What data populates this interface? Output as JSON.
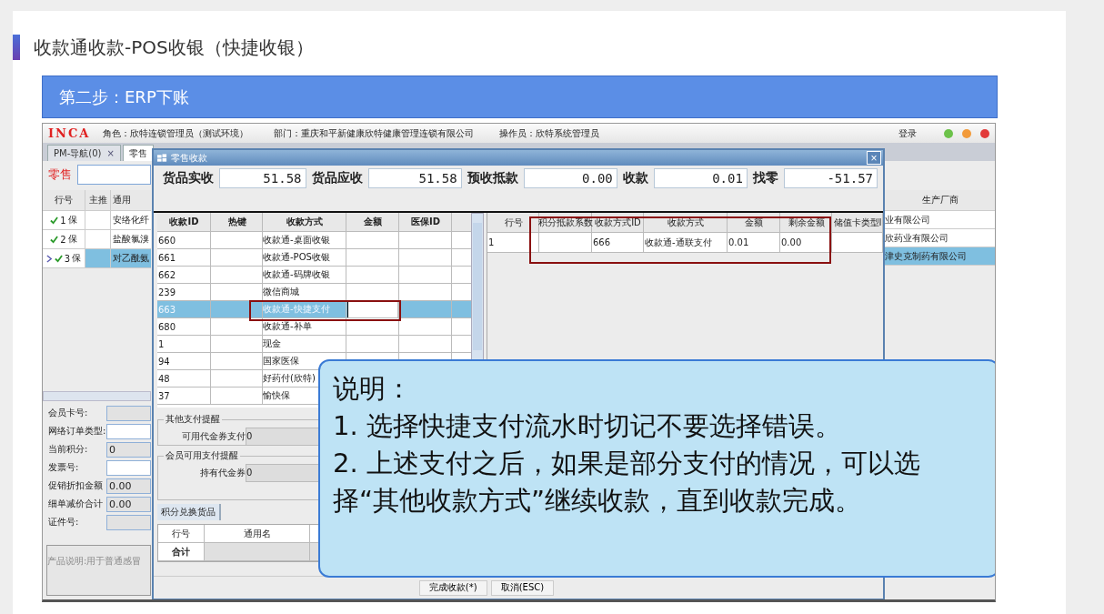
{
  "page_title": "收款通收款-POS收银（快捷收银）",
  "banner": "第二步：ERP下账",
  "app": {
    "logo": "INCA",
    "role": "角色：欣特连锁管理员（测试环境）",
    "department": "部门：重庆和平新健康欣特健康管理连锁有限公司",
    "operator": "操作员：欣特系统管理员",
    "login": "登录",
    "tabs": [
      {
        "label": "PM-导航(0)",
        "close": "×",
        "selected": false
      },
      {
        "label": "零售",
        "selected": true
      }
    ],
    "mode_label": "零售",
    "table": {
      "columns": [
        "行号",
        "主推",
        "通用",
        "生产厂商"
      ],
      "rows": [
        {
          "no": "1",
          "status": "保",
          "name": "安络化纤",
          "manufacturer": "业有限公司",
          "selected": false
        },
        {
          "no": "2",
          "status": "保",
          "name": "盐酸氯溴",
          "manufacturer": "欣药业有限公司",
          "selected": false
        },
        {
          "no": "3",
          "status": "保",
          "name": "对乙酰氨",
          "manufacturer": "津史克制药有限公司",
          "selected": true
        }
      ]
    },
    "fields": [
      {
        "label": "会员卡号:",
        "disabled": true
      },
      {
        "label": "网络订单类型:",
        "disabled": false
      },
      {
        "label": "当前积分:",
        "value": "0",
        "disabled": true
      },
      {
        "label": "发票号:",
        "disabled": false
      },
      {
        "label": "促销折扣金额",
        "value": "0.00",
        "disabled": true
      },
      {
        "label": "细单减价合计",
        "value": "0.00",
        "disabled": true
      },
      {
        "label": "证件号:",
        "disabled": true
      }
    ],
    "description": "产品说明:用于普通感冒"
  },
  "dialog": {
    "title": "零售收款",
    "close": "×",
    "summary": [
      {
        "label": "货品实收",
        "value": "51.58"
      },
      {
        "label": "货品应收",
        "value": "51.58"
      },
      {
        "label": "预收抵款",
        "value": "0.00"
      },
      {
        "label": "收款",
        "value": "0.01"
      },
      {
        "label": "找零",
        "value": "-51.57"
      }
    ],
    "methods": {
      "columns": [
        "收款ID",
        "热键",
        "收款方式",
        "金额",
        "医保ID"
      ],
      "rows": [
        {
          "id": "660",
          "method": "收款通-桌面收银",
          "selected": false,
          "marked": false
        },
        {
          "id": "661",
          "method": "收款通-POS收银",
          "selected": false,
          "marked": false
        },
        {
          "id": "662",
          "method": "收款通-码牌收银",
          "selected": false,
          "marked": false
        },
        {
          "id": "239",
          "method": "微信商城",
          "selected": false,
          "marked": false
        },
        {
          "id": "663",
          "method": "收款通-快捷支付",
          "selected": true,
          "marked": true
        },
        {
          "id": "680",
          "method": "收款通-补单",
          "selected": false,
          "marked": false
        },
        {
          "id": "1",
          "method": "现金",
          "selected": false,
          "marked": false
        },
        {
          "id": "94",
          "method": "国家医保",
          "selected": false,
          "marked": false
        },
        {
          "id": "48",
          "method": "好药付(欣特)",
          "selected": false,
          "marked": false
        },
        {
          "id": "37",
          "method": "愉快保",
          "selected": false,
          "marked": false
        }
      ]
    },
    "payments": {
      "marked": true,
      "columns": [
        "行号",
        "积分抵款系数",
        "收款方式ID",
        "收款方式",
        "金额",
        "剩余金额",
        "储值卡类型I"
      ],
      "rows": [
        [
          "1",
          "",
          "666",
          "收款通-通联支付",
          "0.01",
          "0.00",
          ""
        ]
      ]
    },
    "reminders": [
      {
        "title": "其他支付提醒",
        "label": "可用代金券支付",
        "value": "0"
      },
      {
        "title": "会员可用支付提醒",
        "label": "持有代金券",
        "value": "0"
      }
    ],
    "exchange": {
      "tab": "积分兑换货品",
      "columns": [
        "行号",
        "通用名"
      ],
      "total": "合计"
    },
    "buttons": [
      "完成收款(*)",
      "取消(ESC)"
    ]
  },
  "callout": {
    "heading": "说明：",
    "items": [
      "1. 选择快捷支付流水时切记不要选择错误。",
      "2. 上述支付之后，如果是部分支付的情况，可以选择“其他收款方式”继续收款，直到收款完成。"
    ]
  }
}
